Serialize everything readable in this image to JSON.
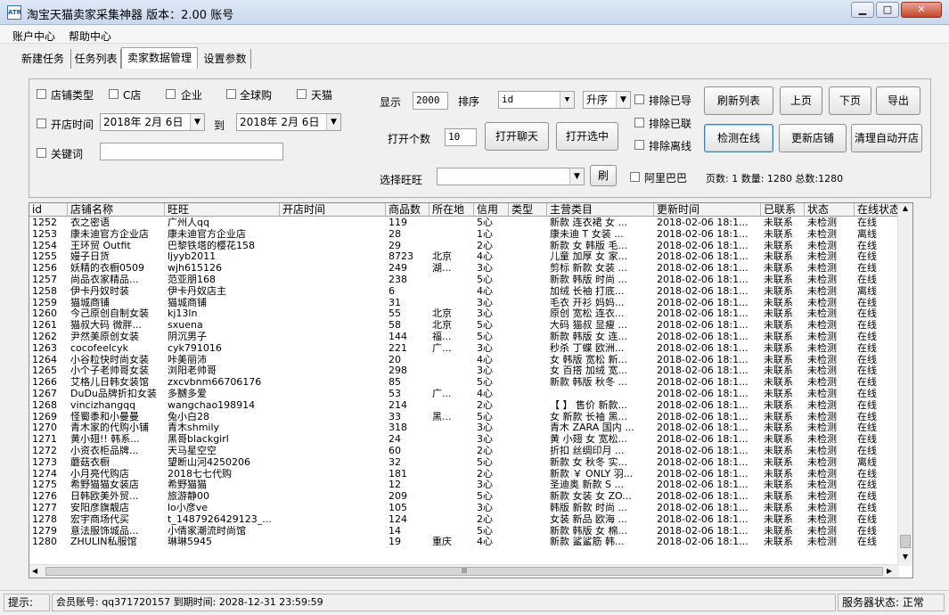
{
  "window": {
    "title": "淘宝天猫卖家采集神器 版本：2.00 账号",
    "icon_text": "ATR"
  },
  "menu": [
    "账户中心",
    "帮助中心"
  ],
  "tabs": [
    "新建任务",
    "任务列表",
    "卖家数据管理",
    "设置参数"
  ],
  "active_tab": 2,
  "filters": {
    "shop_type": "店铺类型",
    "c_shop": "C店",
    "enterprise": "企业",
    "global": "全球购",
    "tmall": "天猫",
    "open_time": "开店时间",
    "date_from": "2018年 2月 6日",
    "to": "到",
    "date_to": "2018年 2月 6日",
    "keyword": "关键词",
    "keyword_value": ""
  },
  "controls": {
    "show_label": "显示",
    "show_value": "2000",
    "sort_label": "排序",
    "sort_field": "id",
    "sort_order": "升序",
    "open_count_label": "打开个数",
    "open_count_value": "10",
    "select_wangwang_label": "选择旺旺",
    "wangwang_value": "",
    "exclude_exported": "排除已导",
    "exclude_contacted": "排除已联",
    "exclude_offline": "排除离线",
    "alibaba": "阿里巴巴",
    "pages_text": "页数: 1 数量: 1280 总数:1280"
  },
  "buttons": {
    "refresh_list": "刷新列表",
    "prev_page": "上页",
    "next_page": "下页",
    "export": "导出",
    "open_chat": "打开聊天",
    "open_selected": "打开选中",
    "check_online": "检测在线",
    "update_shop": "更新店铺",
    "clean_auto": "清理自动开店",
    "refresh_small": "刷"
  },
  "table": {
    "columns": [
      "id",
      "店铺名称",
      "旺旺",
      "开店时间",
      "商品数",
      "所在地",
      "信用",
      "类型",
      "主营类目",
      "更新时间",
      "已联系",
      "状态",
      "在线状态"
    ],
    "rows": [
      [
        "1252",
        "衣之密语",
        "广州人qq",
        "",
        "119",
        "",
        "5心",
        "",
        "新款 连衣裙 女 ...",
        "2018-02-06 18:1...",
        "未联系",
        "未检测",
        "在线"
      ],
      [
        "1253",
        "康未迪官方企业店",
        "康未迪官方企业店",
        "",
        "28",
        "",
        "1心",
        "",
        "康未迪 T 女装 ...",
        "2018-02-06 18:1...",
        "未联系",
        "未检测",
        "离线"
      ],
      [
        "1254",
        "王环贸 Outfit",
        "巴黎铁塔的樱花158",
        "",
        "29",
        "",
        "2心",
        "",
        "新款 女 韩版 毛...",
        "2018-02-06 18:1...",
        "未联系",
        "未检测",
        "在线"
      ],
      [
        "1255",
        "嫚子日货",
        "ljyyb2011",
        "",
        "8723",
        "北京",
        "4心",
        "",
        "儿童 加厚 女 家...",
        "2018-02-06 18:1...",
        "未联系",
        "未检测",
        "在线"
      ],
      [
        "1256",
        "妖精的衣橱0509",
        "wjh615126",
        "",
        "249",
        "湖...",
        "3心",
        "",
        "剪标 新款 女装 ...",
        "2018-02-06 18:1...",
        "未联系",
        "未检测",
        "在线"
      ],
      [
        "1257",
        "尚品衣家精品...",
        "范亚朋168",
        "",
        "238",
        "",
        "5心",
        "",
        "新款 韩版 时尚 ...",
        "2018-02-06 18:1...",
        "未联系",
        "未检测",
        "在线"
      ],
      [
        "1258",
        "伊卡丹奴时装",
        "伊卡丹奴店主",
        "",
        "6",
        "",
        "4心",
        "",
        "加绒 长袖 打底...",
        "2018-02-06 18:1...",
        "未联系",
        "未检测",
        "离线"
      ],
      [
        "1259",
        "猫城商铺",
        "猫城商铺",
        "",
        "31",
        "",
        "3心",
        "",
        "毛衣 开衫 妈妈...",
        "2018-02-06 18:1...",
        "未联系",
        "未检测",
        "在线"
      ],
      [
        "1260",
        "今己原创自制女装",
        "kj13ln",
        "",
        "55",
        "北京",
        "3心",
        "",
        "原创 宽松 连衣...",
        "2018-02-06 18:1...",
        "未联系",
        "未检测",
        "在线"
      ],
      [
        "1261",
        "猫叔大码 微胖...",
        "sxuena",
        "",
        "58",
        "北京",
        "5心",
        "",
        "大码 猫叔 显瘦 ...",
        "2018-02-06 18:1...",
        "未联系",
        "未检测",
        "在线"
      ],
      [
        "1262",
        "尹然美原创女装",
        "阴沉男子",
        "",
        "144",
        "福...",
        "5心",
        "",
        "新款 韩版 女 连...",
        "2018-02-06 18:1...",
        "未联系",
        "未检测",
        "在线"
      ],
      [
        "1263",
        "cocofeelcyk",
        "cyk791016",
        "",
        "221",
        "广...",
        "3心",
        "",
        "秒杀 丁蝶 欧洲...",
        "2018-02-06 18:1...",
        "未联系",
        "未检测",
        "在线"
      ],
      [
        "1264",
        "小谷粒快时尚女装",
        "咔美丽沛",
        "",
        "20",
        "",
        "4心",
        "",
        "女 韩版 宽松 新...",
        "2018-02-06 18:1...",
        "未联系",
        "未检测",
        "在线"
      ],
      [
        "1265",
        "小个子老帅哥女装",
        "浏阳老帅哥",
        "",
        "298",
        "",
        "3心",
        "",
        "女 百搭 加绒 宽...",
        "2018-02-06 18:1...",
        "未联系",
        "未检测",
        "在线"
      ],
      [
        "1266",
        "艾格儿日韩女装馆",
        "zxcvbnm66706176",
        "",
        "85",
        "",
        "5心",
        "",
        "新款 韩版 秋冬 ...",
        "2018-02-06 18:1...",
        "未联系",
        "未检测",
        "在线"
      ],
      [
        "1267",
        "DuDu品牌折扣女装",
        "多嬲多爱",
        "",
        "53",
        "广...",
        "4心",
        "",
        "",
        "2018-02-06 18:1...",
        "未联系",
        "未检测",
        "在线"
      ],
      [
        "1268",
        "vincizhangqq",
        "wangchao198914",
        "",
        "214",
        "",
        "2心",
        "",
        "【 】 售价 新款...",
        "2018-02-06 18:1...",
        "未联系",
        "未检测",
        "在线"
      ],
      [
        "1269",
        "怪蜀黍和小曼曼",
        "兔小白28",
        "",
        "33",
        "黑...",
        "5心",
        "",
        "女 新款 长袖 黑...",
        "2018-02-06 18:1...",
        "未联系",
        "未检测",
        "在线"
      ],
      [
        "1270",
        "青木家的代购小铺",
        "青木shmily",
        "",
        "318",
        "",
        "3心",
        "",
        "青木 ZARA 国内 ...",
        "2018-02-06 18:1...",
        "未联系",
        "未检测",
        "在线"
      ],
      [
        "1271",
        "黄小翅!! 韩系...",
        "黑哥blackgirl",
        "",
        "24",
        "",
        "3心",
        "",
        "黄 小翅 女 宽松...",
        "2018-02-06 18:1...",
        "未联系",
        "未检测",
        "在线"
      ],
      [
        "1272",
        "小资衣柜品牌...",
        "天马星空空",
        "",
        "60",
        "",
        "2心",
        "",
        "折扣 丝绸印月 ...",
        "2018-02-06 18:1...",
        "未联系",
        "未检测",
        "在线"
      ],
      [
        "1273",
        "蘑菇衣橱",
        "望断山河4250206",
        "",
        "32",
        "",
        "5心",
        "",
        "新款 女 秋冬 实...",
        "2018-02-06 18:1...",
        "未联系",
        "未检测",
        "离线"
      ],
      [
        "1274",
        "小月亮代购店",
        "2018七七代购",
        "",
        "181",
        "",
        "2心",
        "",
        "新款 ￥ ONLY 羽...",
        "2018-02-06 18:1...",
        "未联系",
        "未检测",
        "在线"
      ],
      [
        "1275",
        "希野猫猫女装店",
        "希野猫猫",
        "",
        "12",
        "",
        "3心",
        "",
        "圣迪奥 新款 S ...",
        "2018-02-06 18:1...",
        "未联系",
        "未检测",
        "在线"
      ],
      [
        "1276",
        "日韩欧美外贸...",
        "旅游静00",
        "",
        "209",
        "",
        "5心",
        "",
        "新款 女装 女 ZO...",
        "2018-02-06 18:1...",
        "未联系",
        "未检测",
        "在线"
      ],
      [
        "1277",
        "安阳彦旗靓店",
        "lo小彦ve",
        "",
        "105",
        "",
        "3心",
        "",
        "韩版 新款 时尚 ...",
        "2018-02-06 18:1...",
        "未联系",
        "未检测",
        "在线"
      ],
      [
        "1278",
        "宏宇商场代买",
        "t_1487926429123_...",
        "",
        "124",
        "",
        "2心",
        "",
        "女装 新品 欧海 ...",
        "2018-02-06 18:1...",
        "未联系",
        "未检测",
        "在线"
      ],
      [
        "1279",
        "意法服饰城品...",
        "小倩家潮流时尚馆",
        "",
        "14",
        "",
        "5心",
        "",
        "新款 韩版 女 棉...",
        "2018-02-06 18:1...",
        "未联系",
        "未检测",
        "在线"
      ],
      [
        "1280",
        "ZHULIN私服馆",
        "琳琳5945",
        "",
        "19",
        "重庆",
        "4心",
        "",
        "新款 鲨鲨筋 韩...",
        "2018-02-06 18:1...",
        "未联系",
        "未检测",
        "在线"
      ]
    ]
  },
  "statusbar": {
    "hint": "提示:",
    "member": "会员账号: qq371720157 到期时间: 2028-12-31 23:59:59",
    "server": "服务器状态: 正常"
  }
}
